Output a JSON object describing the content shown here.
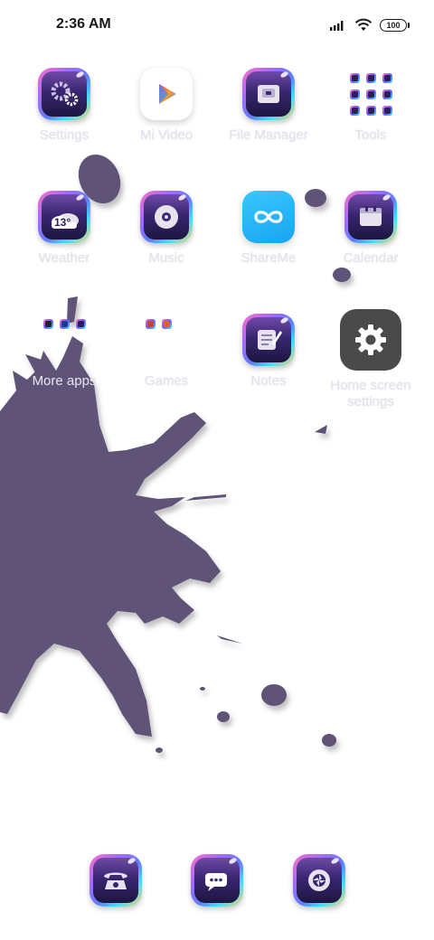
{
  "status_bar": {
    "time": "2:36 AM",
    "battery": "100",
    "icons": [
      "signal-icon",
      "wifi-icon",
      "battery-icon"
    ]
  },
  "apps": {
    "row1": [
      "Settings",
      "Mi Video",
      "File Manager",
      "Tools"
    ],
    "row2": [
      "Weather",
      "Music",
      "ShareMe",
      "Calendar"
    ],
    "row3": [
      "More apps",
      "Games",
      "Notes",
      "Home screen settings"
    ]
  },
  "weather_icon_temp": "13°",
  "dock": [
    "phone-icon",
    "messaging-icon",
    "camera-icon"
  ],
  "theme": {
    "accent_gradient": [
      "#ff6ec4",
      "#a36bff",
      "#5f7cff",
      "#3be0ff",
      "#ffd36e"
    ],
    "splash_color": "#5e5278",
    "label_color": "#e6e2ee"
  }
}
